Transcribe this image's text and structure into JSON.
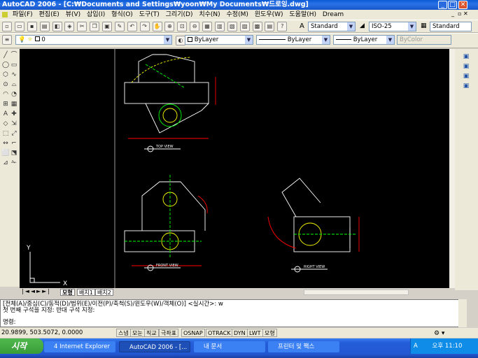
{
  "window": {
    "title": "AutoCAD 2006 - [C:₩Documents and Settings₩yoon₩My Documents₩드로잉.dwg]"
  },
  "menu": [
    "파일(F)",
    "편집(E)",
    "뷰(V)",
    "삽입(I)",
    "형식(O)",
    "도구(T)",
    "그리기(D)",
    "치수(N)",
    "수정(M)",
    "윈도우(W)",
    "도움말(H)",
    "Dream"
  ],
  "styles": {
    "text_style": "Standard",
    "dim_style": "ISO-25",
    "table_style": "Standard"
  },
  "layers": {
    "current_layer": "0",
    "color": "ByLayer",
    "linetype": "ByLayer",
    "lineweight": "ByLayer",
    "plot_style": "ByColor"
  },
  "drawing": {
    "views": [
      "TOP VIEW",
      "FRONT VIEW",
      "RIGHT VIEW"
    ],
    "ucs_x": "X",
    "ucs_y": "Y"
  },
  "layout_tabs": [
    "모형",
    "배치1",
    "배치2"
  ],
  "command": {
    "line1": "[전체(A)/중심(C)/동적(D)/범위(E)/이전(P)/축척(S)/윈도우(W)/객체(O)] <실시간>: w",
    "line2": "첫 번째 구석을 지정: 반대 구석 지정:",
    "prompt": "명령:"
  },
  "status": {
    "coords": "20.9899,  503.5072, 0.0000",
    "toggles": [
      "스냅",
      "모눈",
      "직교",
      "극좌표",
      "OSNAP",
      "OTRACK",
      "DYN",
      "LWT",
      "모형"
    ]
  },
  "taskbar": {
    "start": "시작",
    "tasks": [
      "4 Internet Explorer",
      "AutoCAD 2006 - [...",
      "내 문서",
      "프린터 및 팩스"
    ],
    "ime": "A",
    "clock": "오후 11:10"
  }
}
